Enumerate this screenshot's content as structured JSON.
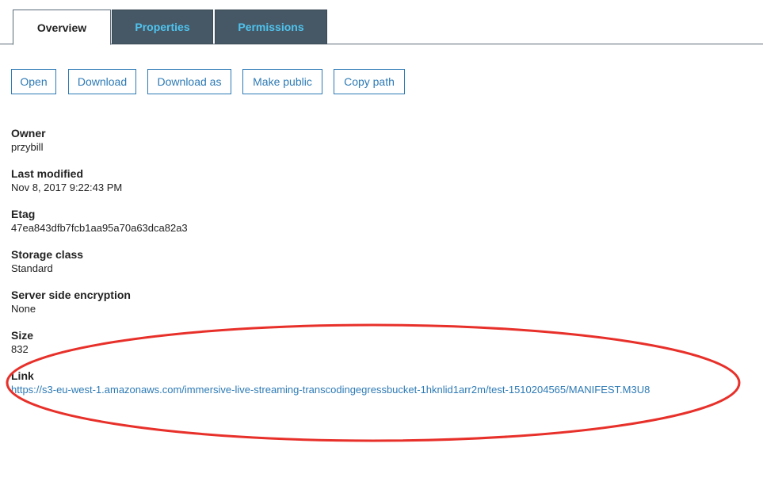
{
  "tabs": {
    "overview": "Overview",
    "properties": "Properties",
    "permissions": "Permissions"
  },
  "actions": {
    "open": "Open",
    "download": "Download",
    "download_as": "Download as",
    "make_public": "Make public",
    "copy_path": "Copy path"
  },
  "details": {
    "owner_label": "Owner",
    "owner_value": "przybill",
    "last_modified_label": "Last modified",
    "last_modified_value": "Nov 8, 2017 9:22:43 PM",
    "etag_label": "Etag",
    "etag_value": "47ea843dfb7fcb1aa95a70a63dca82a3",
    "storage_class_label": "Storage class",
    "storage_class_value": "Standard",
    "encryption_label": "Server side encryption",
    "encryption_value": "None",
    "size_label": "Size",
    "size_value": "832",
    "link_label": "Link",
    "link_value": "https://s3-eu-west-1.amazonaws.com/immersive-live-streaming-transcodingegressbucket-1hknlid1arr2m/test-1510204565/MANIFEST.M3U8"
  },
  "colors": {
    "accent": "#2d7ab5",
    "tab_inactive_bg": "#465865",
    "tab_inactive_text": "#4fc3ee",
    "annotation": "#e8302a"
  }
}
